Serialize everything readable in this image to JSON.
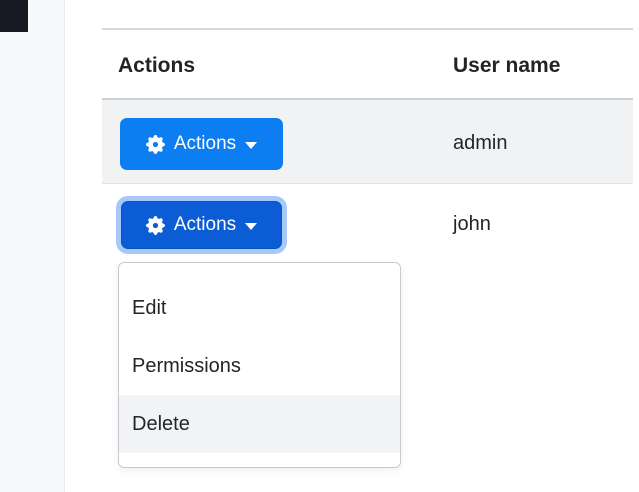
{
  "sidebar": {
    "background": "#f8f9fa"
  },
  "corner_block": {
    "color": "#191923"
  },
  "table": {
    "columns": {
      "actions": "Actions",
      "username": "User name"
    },
    "rows": [
      {
        "user": "admin",
        "button_label": "Actions",
        "state": "default"
      },
      {
        "user": "john",
        "button_label": "Actions",
        "state": "focused-open"
      }
    ]
  },
  "dropdown": {
    "items": [
      {
        "label": "Edit",
        "hovered": false
      },
      {
        "label": "Permissions",
        "hovered": false
      },
      {
        "label": "Delete",
        "hovered": true
      }
    ]
  },
  "colors": {
    "button_primary": "#0d7df2",
    "button_active": "#0b5cd5",
    "focus_ring": "#a6c8fa",
    "row_stripe": "#f1f2f3",
    "item_hover": "#f2f3f7",
    "text": "#212529"
  },
  "icons": {
    "gear": "gear-icon",
    "caret": "chevron-down-icon"
  }
}
